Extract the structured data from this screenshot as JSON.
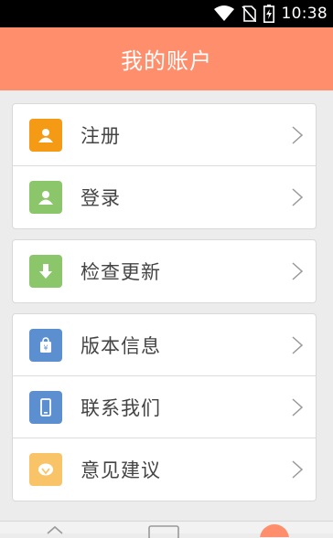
{
  "status_bar": {
    "time": "10:38",
    "icons": [
      "wifi-icon",
      "no-sim-icon",
      "battery-charging-icon"
    ]
  },
  "header": {
    "title": "我的账户"
  },
  "colors": {
    "header_bg": "#ff8f6c",
    "register_icon_bg": "#f59a14",
    "login_icon_bg": "#8cc66a",
    "update_icon_bg": "#8cc66a",
    "version_icon_bg": "#5b8fcf",
    "contact_icon_bg": "#5b8fcf",
    "feedback_icon_bg": "#f9c467"
  },
  "menu": {
    "account_group": [
      {
        "label": "注册",
        "icon": "user-icon"
      },
      {
        "label": "登录",
        "icon": "user-icon"
      }
    ],
    "update_group": [
      {
        "label": "检查更新",
        "icon": "download-icon"
      }
    ],
    "info_group": [
      {
        "label": "版本信息",
        "icon": "bag-icon"
      },
      {
        "label": "联系我们",
        "icon": "phone-icon"
      },
      {
        "label": "意见建议",
        "icon": "feedback-icon"
      }
    ]
  }
}
